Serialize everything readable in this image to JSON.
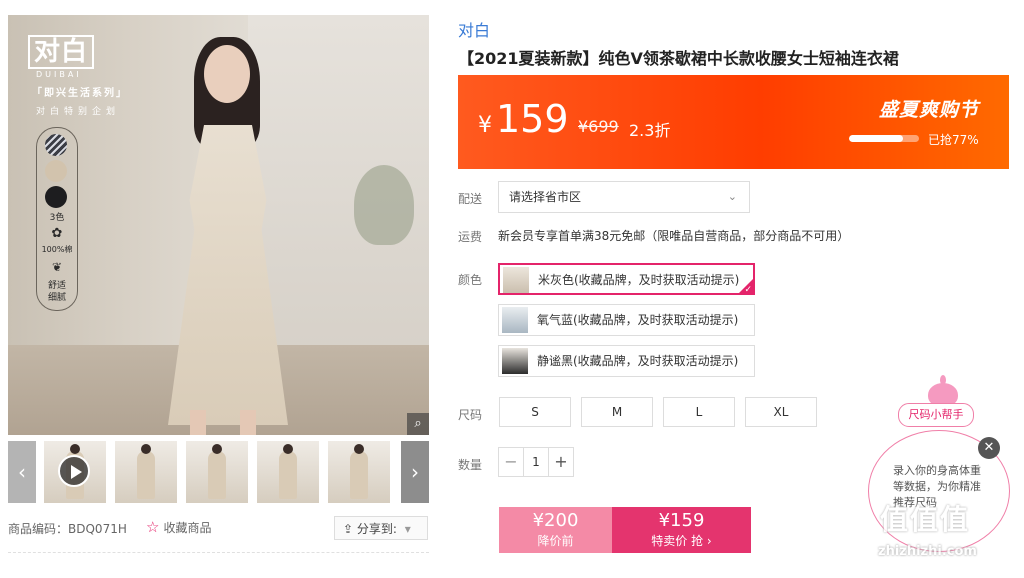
{
  "gallery": {
    "brand_logo": "对白",
    "brand_sub": "DUIBAI",
    "series_title": "「即兴生活系列」",
    "series_sub": "对白特别企划",
    "swatch_colors": [
      "#3b3d45",
      "#d2c3ad",
      "#1d1d1f"
    ],
    "swatch_count_label": "3色",
    "cotton_label": "100%棉",
    "comfort_label_1": "舒适",
    "comfort_label_2": "细腻",
    "zoom_icon": "magnifier-icon"
  },
  "thumbnails": {
    "prev_arrow": "‹",
    "next_arrow": "›",
    "count": 6
  },
  "meta": {
    "sku_label": "商品编码：",
    "sku_value": "BDQ071H",
    "favorite_label": "收藏商品",
    "share_label": "分享到:",
    "share_caret": "▾"
  },
  "product": {
    "brand": "对白",
    "title": "【2021夏装新款】纯色V领茶歇裙中长款收腰女士短袖连衣裙"
  },
  "price": {
    "symbol": "¥",
    "current": "159",
    "original": "¥699",
    "discount": "2.3折",
    "promo_name": "盛夏爽购节",
    "sold_fraction": 0.77,
    "sold_label": "已抢77%"
  },
  "shipping": {
    "label": "配送",
    "select_value": "请选择省市区",
    "fee_label": "运费",
    "fee_text": "新会员专享首单满38元免邮（限唯品自营商品，部分商品不可用）"
  },
  "colors": {
    "label": "颜色",
    "options": [
      {
        "text": "米灰色(收藏品牌，及时获取活动提示)",
        "selected": true
      },
      {
        "text": "氧气蓝(收藏品牌，及时获取活动提示)",
        "selected": false
      },
      {
        "text": "静谧黑(收藏品牌，及时获取活动提示)",
        "selected": false
      }
    ]
  },
  "sizes": {
    "label": "尺码",
    "options": [
      "S",
      "M",
      "L",
      "XL"
    ]
  },
  "quantity": {
    "label": "数量",
    "value": "1",
    "minus": "−",
    "plus": "+"
  },
  "buy": {
    "before_price": "¥200",
    "before_label": "降价前",
    "now_price": "¥159",
    "now_label": "特卖价 抢 ›"
  },
  "helper": {
    "tag": "尺码小帮手",
    "text": "录入你的身高体重等数据，为你精准推荐尺码",
    "close": "✕"
  },
  "watermark": {
    "logo": "值值值",
    "domain": "zhizhizhi.com"
  },
  "accent_colors": {
    "brand_pink": "#e4246a",
    "promo_orange": "#ff3d00",
    "link_blue": "#3a7bd5"
  }
}
